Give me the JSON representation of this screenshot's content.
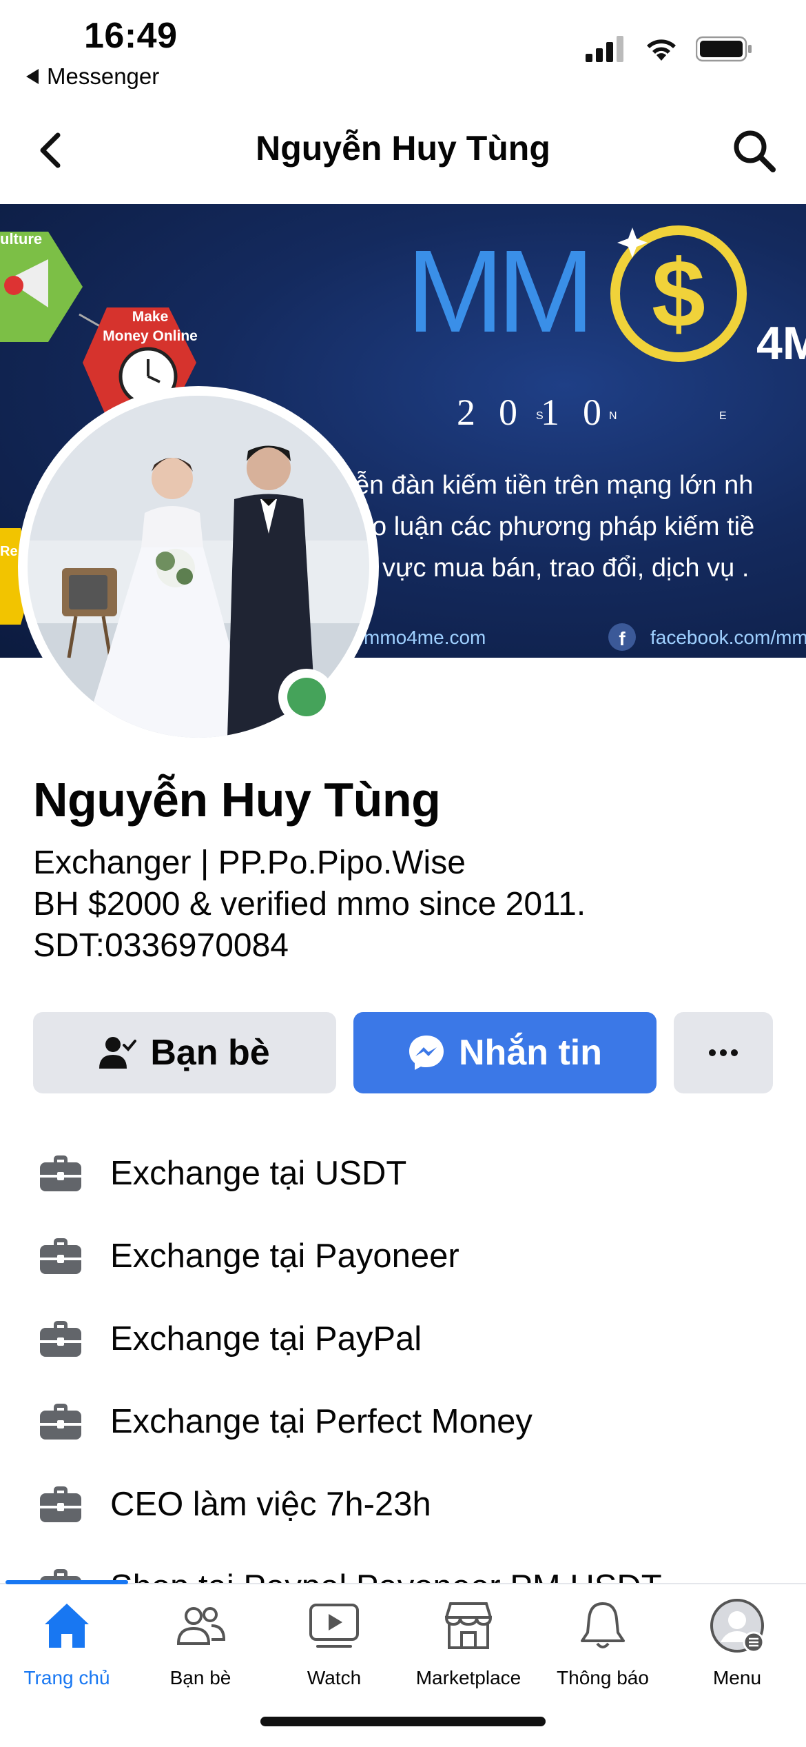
{
  "status_bar": {
    "time": "16:49",
    "back_app": "Messenger"
  },
  "header": {
    "title": "Nguyễn Huy Tùng"
  },
  "cover": {
    "logo_mm": "MM",
    "logo_dollar": "$",
    "logo_suffix": "4M",
    "year": "2010",
    "year_letters": [
      "S",
      "N",
      "E"
    ],
    "line1": "ễn đàn kiếm tiền trên mạng lớn nh",
    "line2": "o luận các phương pháp kiếm tiề",
    "line3": "vực mua bán, trao đổi, dịch vụ .",
    "website": "mmo4me.com",
    "facebook": "facebook.com/mm",
    "badge_culture": "ulture",
    "badge_make": "Make",
    "badge_money": "Money Online",
    "badge_re": "Re"
  },
  "profile": {
    "name": "Nguyễn Huy Tùng",
    "bio": [
      "Exchanger | PP.Po.Pipo.Wise",
      "BH $2000 & verified mmo since 2011.",
      "SDT:0336970084"
    ],
    "online": true
  },
  "actions": {
    "friends_label": "Bạn bè",
    "message_label": "Nhắn tin"
  },
  "info_items": [
    "Exchange tại USDT",
    "Exchange tại Payoneer",
    "Exchange tại PayPal",
    "Exchange tại Perfect Money",
    "CEO làm việc 7h-23h",
    "Shop tại Paypal Payoneer PM USDT"
  ],
  "tabs": [
    {
      "label": "Trang chủ",
      "icon": "home-icon",
      "active": true
    },
    {
      "label": "Bạn bè",
      "icon": "friends-icon"
    },
    {
      "label": "Watch",
      "icon": "watch-icon"
    },
    {
      "label": "Marketplace",
      "icon": "marketplace-icon"
    },
    {
      "label": "Thông báo",
      "icon": "bell-icon"
    },
    {
      "label": "Menu",
      "icon": "menu-avatar-icon"
    }
  ],
  "colors": {
    "accent": "#1877f2",
    "message_button": "#3b78e7",
    "online": "#45a35a"
  }
}
